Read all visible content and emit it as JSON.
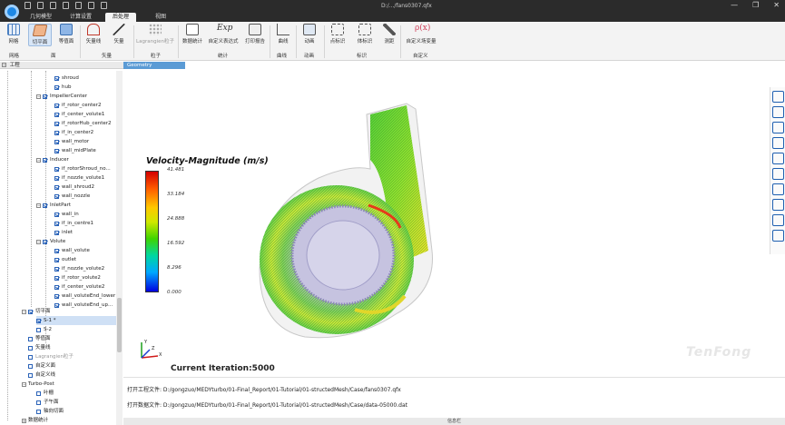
{
  "window": {
    "title": "D:/.../fans0307.qfx",
    "minimize": "—",
    "restore": "❐",
    "close": "✕"
  },
  "tabs": [
    {
      "label": "几何模型"
    },
    {
      "label": "计算设置"
    },
    {
      "label": "后处理"
    },
    {
      "label": "视图"
    }
  ],
  "ribbon": {
    "buttons": [
      {
        "label": "网格"
      },
      {
        "label": "切平面"
      },
      {
        "label": "等值面"
      },
      {
        "label": "矢量线"
      },
      {
        "label": "矢量"
      },
      {
        "label": "Lagrangien粒子"
      },
      {
        "label": "数据统计"
      },
      {
        "label": "自定义表达式"
      },
      {
        "label": "打印报告"
      },
      {
        "label": "曲线"
      },
      {
        "label": "动画"
      },
      {
        "label": "点标识"
      },
      {
        "label": "体标识"
      },
      {
        "label": "测距"
      },
      {
        "label": "自定义场变量"
      }
    ],
    "exp_icon": "Exp",
    "rho_icon": "ρ(x)",
    "groups": [
      {
        "label": "网格"
      },
      {
        "label": "面"
      },
      {
        "label": "矢量"
      },
      {
        "label": "粒子"
      },
      {
        "label": "统计"
      },
      {
        "label": "曲线"
      },
      {
        "label": "动画"
      },
      {
        "label": "标识"
      },
      {
        "label": "自定义"
      }
    ]
  },
  "geometry_tab": "Geometry",
  "panel": {
    "header": "工程",
    "tree": [
      {
        "label": "shroud"
      },
      {
        "label": "hub"
      },
      {
        "label": "ImpellerCenter"
      },
      {
        "label": "if_rotor_center2"
      },
      {
        "label": "if_center_volute1"
      },
      {
        "label": "if_rotorHub_center2"
      },
      {
        "label": "if_in_center2"
      },
      {
        "label": "wall_motor"
      },
      {
        "label": "wall_midPlate"
      },
      {
        "label": "Inducer"
      },
      {
        "label": "if_rotorShroud_no..."
      },
      {
        "label": "if_nozzle_volute1"
      },
      {
        "label": "wall_shroud2"
      },
      {
        "label": "wall_nozzle"
      },
      {
        "label": "InletPart"
      },
      {
        "label": "wall_in"
      },
      {
        "label": "if_in_centre1"
      },
      {
        "label": "inlet"
      },
      {
        "label": "Volute"
      },
      {
        "label": "wall_volute"
      },
      {
        "label": "outlet"
      },
      {
        "label": "if_nozzle_volute2"
      },
      {
        "label": "if_rotor_volute2"
      },
      {
        "label": "if_center_volute2"
      },
      {
        "label": "wall_voluteEnd_lower"
      },
      {
        "label": "wall_voluteEnd_up..."
      },
      {
        "label": "切平面"
      },
      {
        "label": "S-1 *"
      },
      {
        "label": "S-2"
      },
      {
        "label": "等值面"
      },
      {
        "label": "矢量线"
      },
      {
        "label": "Lagrangien粒子"
      },
      {
        "label": "自定义面"
      },
      {
        "label": "自定义线"
      },
      {
        "label": "Turbo-Post"
      },
      {
        "label": "叶栅"
      },
      {
        "label": "子午面"
      },
      {
        "label": "轴向切面"
      },
      {
        "label": "数据统计"
      }
    ]
  },
  "viewport": {
    "legend_title": "Velocity-Magnitude (m/s)",
    "legend_ticks": [
      "41.481",
      "33.184",
      "24.888",
      "16.592",
      "8.296",
      "0.000"
    ],
    "axis_labels": {
      "x": "X",
      "y": "Y",
      "z": "Z"
    },
    "iteration": "Current Iteration:5000",
    "watermark": "TenFong",
    "colors": {
      "high": "#d40000",
      "mid": "#3fd400",
      "low": "#0000e0"
    }
  },
  "log": {
    "line1": "打开工程文件: D:/gongzuo/MEDYturbo/01-Final_Report/01-Tutorial/01-structedMesh/Case/fans0307.qfx",
    "line2": "打开数据文件: D:/gongzuo/MEDYturbo/01-Final_Report/01-Tutorial/01-structedMesh/Case/data-05000.dat"
  },
  "statusbar": {
    "label": "信息栏"
  }
}
